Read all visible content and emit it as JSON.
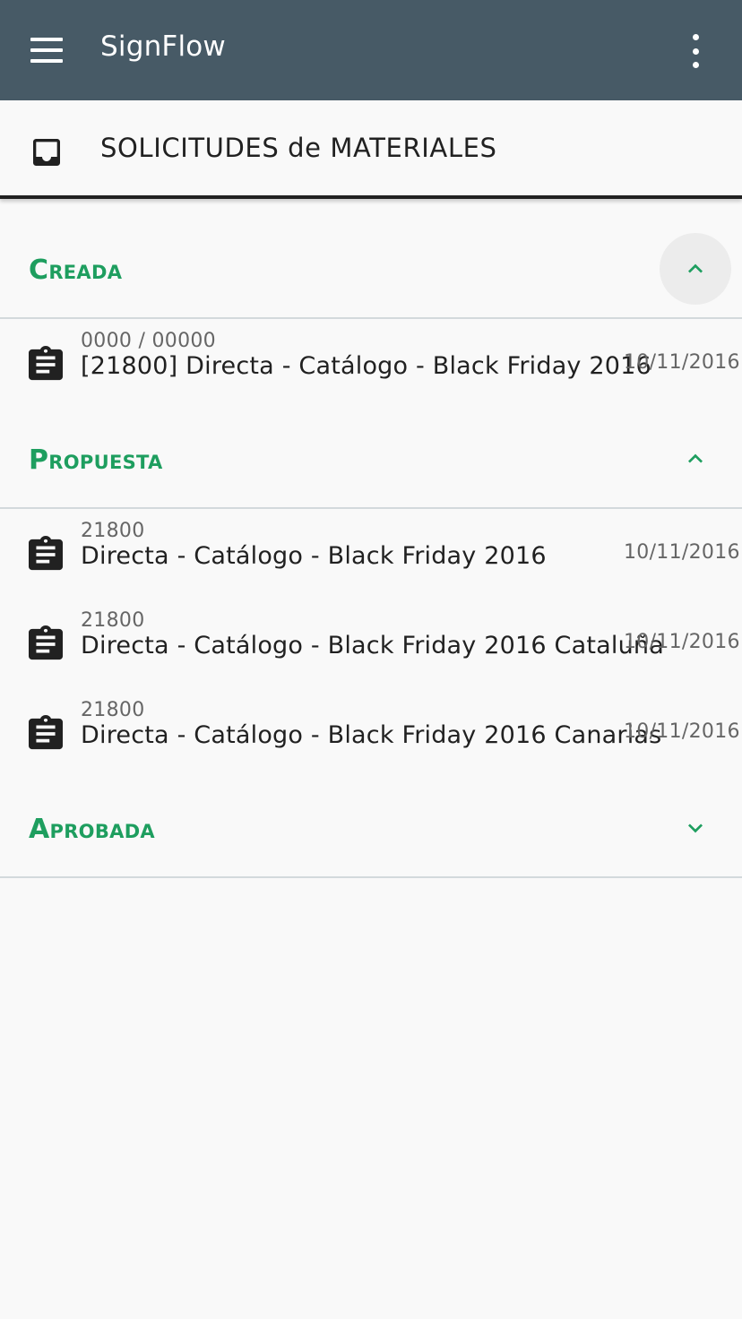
{
  "appbar": {
    "title": "SignFlow",
    "menu_icon": "hamburger-menu-icon",
    "more_icon": "more-vertical-icon",
    "color": "#475a66"
  },
  "subbar": {
    "title": "SOLICITUDES de MATERIALES",
    "left_icon": "inbox-icon",
    "right_icon": "search-icon"
  },
  "accent_color": "#1e9e5f",
  "groups": [
    {
      "title": "Creada",
      "expanded": true,
      "items": [
        {
          "code": "0000 / 00000",
          "name": "[21800] Directa - Catálogo - Black Friday 2016",
          "date": "10/11/2016"
        }
      ]
    },
    {
      "title": "Propuesta",
      "expanded": true,
      "items": [
        {
          "code": "21800",
          "name": "Directa - Catálogo - Black Friday 2016",
          "date": "10/11/2016"
        },
        {
          "code": "21800",
          "name": "Directa - Catálogo - Black Friday 2016 Cataluña",
          "date": "10/11/2016"
        },
        {
          "code": "21800",
          "name": "Directa - Catálogo - Black Friday 2016 Canarias",
          "date": "10/11/2016"
        }
      ]
    },
    {
      "title": "Aprobada",
      "expanded": false,
      "items": []
    }
  ]
}
